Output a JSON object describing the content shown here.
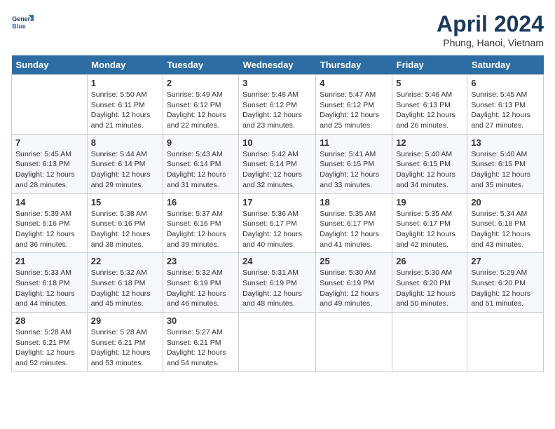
{
  "header": {
    "logo_line1": "General",
    "logo_line2": "Blue",
    "title": "April 2024",
    "subtitle": "Phung, Hanoi, Vietnam"
  },
  "columns": [
    "Sunday",
    "Monday",
    "Tuesday",
    "Wednesday",
    "Thursday",
    "Friday",
    "Saturday"
  ],
  "weeks": [
    [
      {
        "day": "",
        "content": ""
      },
      {
        "day": "1",
        "content": "Sunrise: 5:50 AM\nSunset: 6:11 PM\nDaylight: 12 hours\nand 21 minutes."
      },
      {
        "day": "2",
        "content": "Sunrise: 5:49 AM\nSunset: 6:12 PM\nDaylight: 12 hours\nand 22 minutes."
      },
      {
        "day": "3",
        "content": "Sunrise: 5:48 AM\nSunset: 6:12 PM\nDaylight: 12 hours\nand 23 minutes."
      },
      {
        "day": "4",
        "content": "Sunrise: 5:47 AM\nSunset: 6:12 PM\nDaylight: 12 hours\nand 25 minutes."
      },
      {
        "day": "5",
        "content": "Sunrise: 5:46 AM\nSunset: 6:13 PM\nDaylight: 12 hours\nand 26 minutes."
      },
      {
        "day": "6",
        "content": "Sunrise: 5:45 AM\nSunset: 6:13 PM\nDaylight: 12 hours\nand 27 minutes."
      }
    ],
    [
      {
        "day": "7",
        "content": "Sunrise: 5:45 AM\nSunset: 6:13 PM\nDaylight: 12 hours\nand 28 minutes."
      },
      {
        "day": "8",
        "content": "Sunrise: 5:44 AM\nSunset: 6:14 PM\nDaylight: 12 hours\nand 29 minutes."
      },
      {
        "day": "9",
        "content": "Sunrise: 5:43 AM\nSunset: 6:14 PM\nDaylight: 12 hours\nand 31 minutes."
      },
      {
        "day": "10",
        "content": "Sunrise: 5:42 AM\nSunset: 6:14 PM\nDaylight: 12 hours\nand 32 minutes."
      },
      {
        "day": "11",
        "content": "Sunrise: 5:41 AM\nSunset: 6:15 PM\nDaylight: 12 hours\nand 33 minutes."
      },
      {
        "day": "12",
        "content": "Sunrise: 5:40 AM\nSunset: 6:15 PM\nDaylight: 12 hours\nand 34 minutes."
      },
      {
        "day": "13",
        "content": "Sunrise: 5:40 AM\nSunset: 6:15 PM\nDaylight: 12 hours\nand 35 minutes."
      }
    ],
    [
      {
        "day": "14",
        "content": "Sunrise: 5:39 AM\nSunset: 6:16 PM\nDaylight: 12 hours\nand 36 minutes."
      },
      {
        "day": "15",
        "content": "Sunrise: 5:38 AM\nSunset: 6:16 PM\nDaylight: 12 hours\nand 38 minutes."
      },
      {
        "day": "16",
        "content": "Sunrise: 5:37 AM\nSunset: 6:16 PM\nDaylight: 12 hours\nand 39 minutes."
      },
      {
        "day": "17",
        "content": "Sunrise: 5:36 AM\nSunset: 6:17 PM\nDaylight: 12 hours\nand 40 minutes."
      },
      {
        "day": "18",
        "content": "Sunrise: 5:35 AM\nSunset: 6:17 PM\nDaylight: 12 hours\nand 41 minutes."
      },
      {
        "day": "19",
        "content": "Sunrise: 5:35 AM\nSunset: 6:17 PM\nDaylight: 12 hours\nand 42 minutes."
      },
      {
        "day": "20",
        "content": "Sunrise: 5:34 AM\nSunset: 6:18 PM\nDaylight: 12 hours\nand 43 minutes."
      }
    ],
    [
      {
        "day": "21",
        "content": "Sunrise: 5:33 AM\nSunset: 6:18 PM\nDaylight: 12 hours\nand 44 minutes."
      },
      {
        "day": "22",
        "content": "Sunrise: 5:32 AM\nSunset: 6:18 PM\nDaylight: 12 hours\nand 45 minutes."
      },
      {
        "day": "23",
        "content": "Sunrise: 5:32 AM\nSunset: 6:19 PM\nDaylight: 12 hours\nand 46 minutes."
      },
      {
        "day": "24",
        "content": "Sunrise: 5:31 AM\nSunset: 6:19 PM\nDaylight: 12 hours\nand 48 minutes."
      },
      {
        "day": "25",
        "content": "Sunrise: 5:30 AM\nSunset: 6:19 PM\nDaylight: 12 hours\nand 49 minutes."
      },
      {
        "day": "26",
        "content": "Sunrise: 5:30 AM\nSunset: 6:20 PM\nDaylight: 12 hours\nand 50 minutes."
      },
      {
        "day": "27",
        "content": "Sunrise: 5:29 AM\nSunset: 6:20 PM\nDaylight: 12 hours\nand 51 minutes."
      }
    ],
    [
      {
        "day": "28",
        "content": "Sunrise: 5:28 AM\nSunset: 6:21 PM\nDaylight: 12 hours\nand 52 minutes."
      },
      {
        "day": "29",
        "content": "Sunrise: 5:28 AM\nSunset: 6:21 PM\nDaylight: 12 hours\nand 53 minutes."
      },
      {
        "day": "30",
        "content": "Sunrise: 5:27 AM\nSunset: 6:21 PM\nDaylight: 12 hours\nand 54 minutes."
      },
      {
        "day": "",
        "content": ""
      },
      {
        "day": "",
        "content": ""
      },
      {
        "day": "",
        "content": ""
      },
      {
        "day": "",
        "content": ""
      }
    ]
  ]
}
